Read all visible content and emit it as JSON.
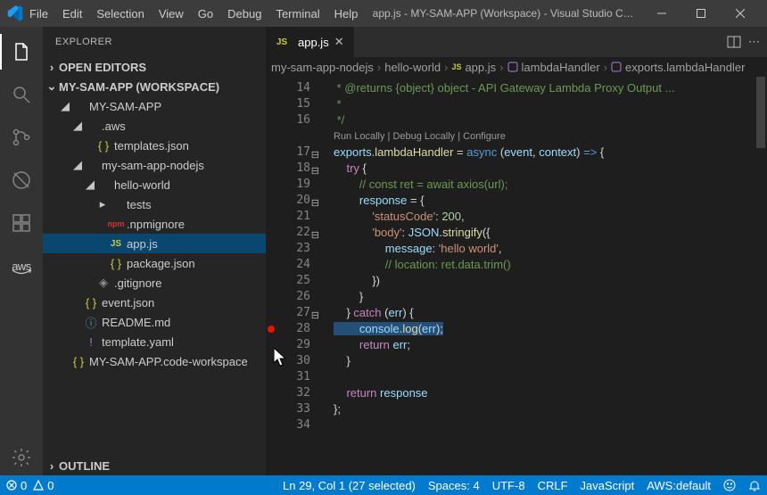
{
  "menus": [
    "File",
    "Edit",
    "Selection",
    "View",
    "Go",
    "Debug",
    "Terminal",
    "Help"
  ],
  "app_title": "app.js - MY-SAM-APP (Workspace) - Visual Studio C…",
  "explorer_title": "EXPLORER",
  "sections": {
    "open_editors": "OPEN EDITORS",
    "workspace": "MY-SAM-APP (WORKSPACE)",
    "outline": "OUTLINE"
  },
  "tree": [
    {
      "d": 1,
      "exp": "down",
      "ic": "folder",
      "label": "MY-SAM-APP"
    },
    {
      "d": 2,
      "exp": "down",
      "ic": "",
      "label": ".aws"
    },
    {
      "d": 3,
      "exp": "none",
      "ic": "json",
      "label": "templates.json"
    },
    {
      "d": 2,
      "exp": "down",
      "ic": "",
      "label": "my-sam-app-nodejs"
    },
    {
      "d": 3,
      "exp": "down",
      "ic": "",
      "label": "hello-world"
    },
    {
      "d": 4,
      "exp": "right",
      "ic": "",
      "label": "tests"
    },
    {
      "d": 4,
      "exp": "none",
      "ic": "npm",
      "label": ".npmignore"
    },
    {
      "d": 4,
      "exp": "none",
      "ic": "js",
      "label": "app.js",
      "sel": true
    },
    {
      "d": 4,
      "exp": "none",
      "ic": "json",
      "label": "package.json"
    },
    {
      "d": 3,
      "exp": "none",
      "ic": "git",
      "label": ".gitignore"
    },
    {
      "d": 2,
      "exp": "none",
      "ic": "json",
      "label": "event.json"
    },
    {
      "d": 2,
      "exp": "none",
      "ic": "info",
      "label": "README.md"
    },
    {
      "d": 2,
      "exp": "none",
      "ic": "yaml",
      "label": "template.yaml"
    },
    {
      "d": 1,
      "exp": "none",
      "ic": "json",
      "label": "MY-SAM-APP.code-workspace"
    }
  ],
  "tab": {
    "file": "app.js"
  },
  "breadcrumbs": [
    {
      "ic": "folder",
      "t": "my-sam-app-nodejs"
    },
    {
      "ic": "folder",
      "t": "hello-world"
    },
    {
      "ic": "js",
      "t": "app.js"
    },
    {
      "ic": "fn",
      "t": "lambdaHandler"
    },
    {
      "ic": "fn",
      "t": "exports.lambdaHandler"
    }
  ],
  "codelens": "Run Locally | Debug Locally | Configure",
  "first_line": 14,
  "code": [
    {
      "n": 14,
      "seg": [
        {
          "c": "cm",
          "t": " * @returns {object} object - API Gateway Lambda Proxy Output ..."
        }
      ]
    },
    {
      "n": 15,
      "seg": [
        {
          "c": "cm",
          "t": " *"
        }
      ]
    },
    {
      "n": 16,
      "seg": [
        {
          "c": "cm",
          "t": " */"
        }
      ]
    },
    {
      "codelens": true
    },
    {
      "n": 17,
      "fold": "-",
      "seg": [
        {
          "c": "va",
          "t": "exports"
        },
        {
          "c": "",
          "t": "."
        },
        {
          "c": "fn",
          "t": "lambdaHandler"
        },
        {
          "c": "",
          "t": " = "
        },
        {
          "c": "kw",
          "t": "async"
        },
        {
          "c": "",
          "t": " ("
        },
        {
          "c": "va",
          "t": "event"
        },
        {
          "c": "",
          "t": ", "
        },
        {
          "c": "va",
          "t": "context"
        },
        {
          "c": "",
          "t": ") "
        },
        {
          "c": "kw",
          "t": "=>"
        },
        {
          "c": "",
          "t": " {"
        }
      ]
    },
    {
      "n": 18,
      "fold": "-",
      "seg": [
        {
          "c": "",
          "t": "    "
        },
        {
          "c": "cc",
          "t": "try"
        },
        {
          "c": "",
          "t": " {"
        }
      ]
    },
    {
      "n": 19,
      "seg": [
        {
          "c": "",
          "t": "        "
        },
        {
          "c": "cm",
          "t": "// const ret = await axios(url);"
        }
      ]
    },
    {
      "n": 20,
      "fold": "-",
      "seg": [
        {
          "c": "",
          "t": "        "
        },
        {
          "c": "va",
          "t": "response"
        },
        {
          "c": "",
          "t": " = {"
        }
      ]
    },
    {
      "n": 21,
      "seg": [
        {
          "c": "",
          "t": "            "
        },
        {
          "c": "str",
          "t": "'statusCode'"
        },
        {
          "c": "",
          "t": ": "
        },
        {
          "c": "num",
          "t": "200"
        },
        {
          "c": "",
          "t": ","
        }
      ]
    },
    {
      "n": 22,
      "fold": "-",
      "seg": [
        {
          "c": "",
          "t": "            "
        },
        {
          "c": "str",
          "t": "'body'"
        },
        {
          "c": "",
          "t": ": "
        },
        {
          "c": "va",
          "t": "JSON"
        },
        {
          "c": "",
          "t": "."
        },
        {
          "c": "fn",
          "t": "stringify"
        },
        {
          "c": "",
          "t": "({"
        }
      ]
    },
    {
      "n": 23,
      "seg": [
        {
          "c": "",
          "t": "                "
        },
        {
          "c": "va",
          "t": "message"
        },
        {
          "c": "",
          "t": ": "
        },
        {
          "c": "str",
          "t": "'hello world'"
        },
        {
          "c": "",
          "t": ","
        }
      ]
    },
    {
      "n": 24,
      "seg": [
        {
          "c": "",
          "t": "                "
        },
        {
          "c": "cm",
          "t": "// location: ret.data.trim()"
        }
      ]
    },
    {
      "n": 25,
      "seg": [
        {
          "c": "",
          "t": "            })"
        }
      ]
    },
    {
      "n": 26,
      "seg": [
        {
          "c": "",
          "t": "        }"
        }
      ]
    },
    {
      "n": 27,
      "fold": "-",
      "seg": [
        {
          "c": "",
          "t": "    } "
        },
        {
          "c": "cc",
          "t": "catch"
        },
        {
          "c": "",
          "t": " ("
        },
        {
          "c": "va",
          "t": "err"
        },
        {
          "c": "",
          "t": ") {"
        }
      ]
    },
    {
      "n": 28,
      "bkpt": true,
      "seg": [
        {
          "c": "",
          "t": "        ",
          "selStart": true
        },
        {
          "c": "va",
          "t": "console"
        },
        {
          "c": "",
          "t": "."
        },
        {
          "c": "fn",
          "t": "log"
        },
        {
          "c": "",
          "t": "("
        },
        {
          "c": "va",
          "t": "err"
        },
        {
          "c": "",
          "t": ");",
          "selEnd": true
        }
      ]
    },
    {
      "n": 29,
      "seg": [
        {
          "c": "",
          "t": "        "
        },
        {
          "c": "cc",
          "t": "return"
        },
        {
          "c": "",
          "t": " "
        },
        {
          "c": "va",
          "t": "err"
        },
        {
          "c": "",
          "t": ";"
        }
      ]
    },
    {
      "n": 30,
      "seg": [
        {
          "c": "",
          "t": "    }"
        }
      ]
    },
    {
      "n": 31,
      "seg": [
        {
          "c": "",
          "t": ""
        }
      ]
    },
    {
      "n": 32,
      "seg": [
        {
          "c": "",
          "t": "    "
        },
        {
          "c": "cc",
          "t": "return"
        },
        {
          "c": "",
          "t": " "
        },
        {
          "c": "va",
          "t": "response"
        }
      ]
    },
    {
      "n": 33,
      "seg": [
        {
          "c": "",
          "t": "};"
        }
      ]
    },
    {
      "n": 34,
      "seg": [
        {
          "c": "",
          "t": ""
        }
      ]
    }
  ],
  "status": {
    "errors": "0",
    "warnings": "0",
    "pos": "Ln 29, Col 1 (27 selected)",
    "spaces": "Spaces: 4",
    "enc": "UTF-8",
    "eol": "CRLF",
    "lang": "JavaScript",
    "aws": "AWS:default"
  }
}
